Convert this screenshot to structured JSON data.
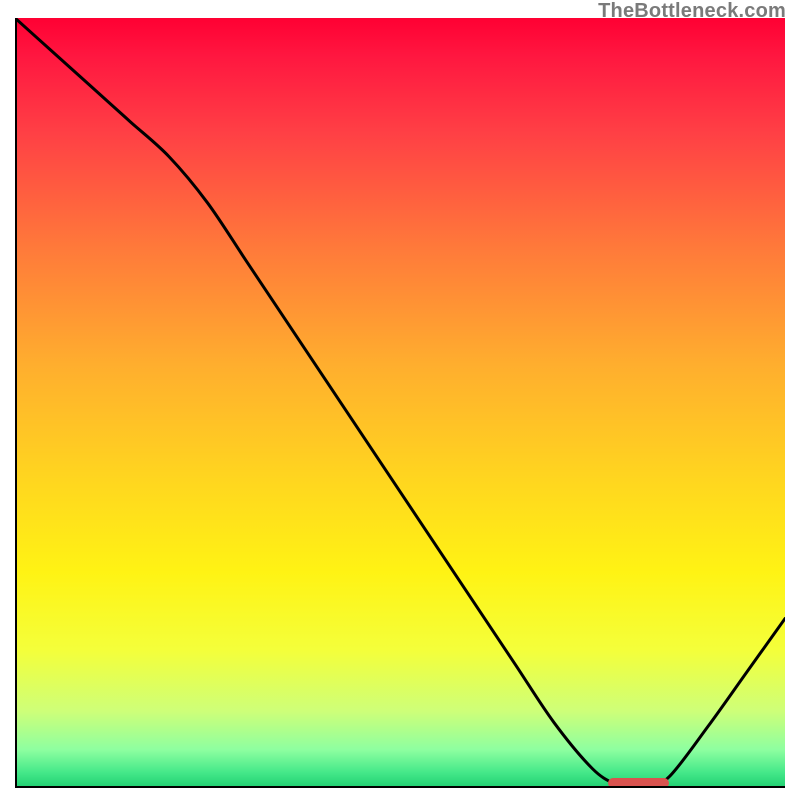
{
  "watermark": "TheBottleneck.com",
  "chart_data": {
    "type": "line",
    "title": "",
    "xlabel": "",
    "ylabel": "",
    "xlim": [
      0,
      100
    ],
    "ylim": [
      0,
      100
    ],
    "x": [
      0,
      5,
      10,
      15,
      20,
      25,
      30,
      35,
      40,
      45,
      50,
      55,
      60,
      65,
      70,
      75,
      78,
      80,
      82,
      85,
      90,
      95,
      100
    ],
    "values": [
      100,
      95.5,
      91,
      86.5,
      82,
      76,
      68.5,
      61,
      53.5,
      46,
      38.5,
      31,
      23.5,
      16,
      8.5,
      2.5,
      0.5,
      0,
      0,
      1.5,
      8,
      15,
      22
    ],
    "optimal_range_x": [
      77,
      85
    ],
    "gradient_stops": [
      {
        "pos": 0.0,
        "color": "#ff0033"
      },
      {
        "pos": 0.05,
        "color": "#ff1740"
      },
      {
        "pos": 0.15,
        "color": "#ff4045"
      },
      {
        "pos": 0.3,
        "color": "#ff7a3a"
      },
      {
        "pos": 0.45,
        "color": "#ffae2e"
      },
      {
        "pos": 0.6,
        "color": "#ffd61f"
      },
      {
        "pos": 0.72,
        "color": "#fff314"
      },
      {
        "pos": 0.82,
        "color": "#f4ff3a"
      },
      {
        "pos": 0.9,
        "color": "#ceff78"
      },
      {
        "pos": 0.95,
        "color": "#8effa0"
      },
      {
        "pos": 0.98,
        "color": "#44e889"
      },
      {
        "pos": 1.0,
        "color": "#1fcf71"
      }
    ],
    "marker_color": "#d9534f"
  }
}
